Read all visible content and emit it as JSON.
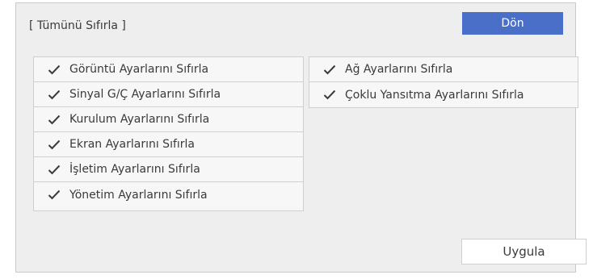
{
  "dialog": {
    "title": "[ Tümünü Sıfırla ]",
    "back_label": "Dön",
    "apply_label": "Uygula"
  },
  "left_items": [
    {
      "label": "Görüntü Ayarlarını Sıfırla",
      "checked": true
    },
    {
      "label": "Sinyal G/Ç Ayarlarını Sıfırla",
      "checked": true
    },
    {
      "label": "Kurulum Ayarlarını Sıfırla",
      "checked": true
    },
    {
      "label": "Ekran Ayarlarını Sıfırla",
      "checked": true
    },
    {
      "label": "İşletim Ayarlarını Sıfırla",
      "checked": true
    },
    {
      "label": "Yönetim Ayarlarını Sıfırla",
      "checked": true
    }
  ],
  "right_items": [
    {
      "label": "Ağ Ayarlarını Sıfırla",
      "checked": true
    },
    {
      "label": "Çoklu Yansıtma Ayarlarını Sıfırla",
      "checked": true
    }
  ],
  "icons": {
    "check": "checkmark-icon"
  },
  "colors": {
    "accent": "#4a6fc8",
    "panel_bg": "#eeeeee"
  }
}
